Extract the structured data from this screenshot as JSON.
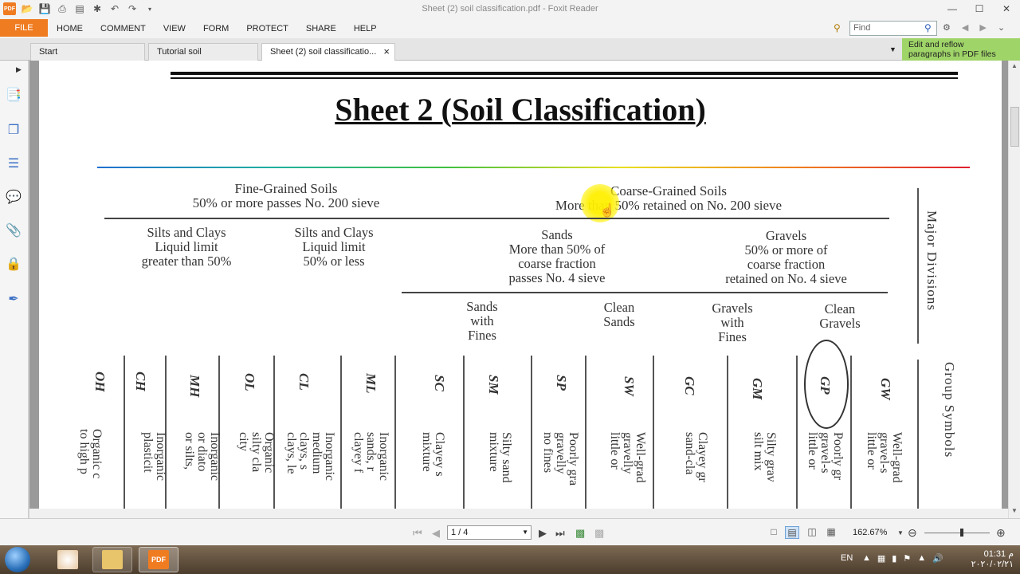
{
  "window": {
    "title": "Sheet (2) soil classification.pdf - Foxit Reader",
    "controls": [
      "—",
      "☐",
      "✕"
    ]
  },
  "ribbon": {
    "file_label": "FILE",
    "tabs": [
      "HOME",
      "COMMENT",
      "VIEW",
      "FORM",
      "PROTECT",
      "SHARE",
      "HELP"
    ],
    "find_placeholder": "Find",
    "reflow_line1": "Edit and reflow",
    "reflow_line2": "paragraphs in PDF files"
  },
  "doc_tabs": [
    {
      "label": "Start"
    },
    {
      "label": "Tutorial soil classificatio..."
    },
    {
      "label": "Sheet (2) soil classificatio...",
      "close": "×"
    }
  ],
  "document": {
    "title": "Sheet 2 (Soil Classification)",
    "fine": {
      "line1": "Fine-Grained Soils",
      "line2": "50% or more passes No. 200 sieve",
      "group1": [
        "Silts and Clays",
        "Liquid limit",
        "greater than 50%"
      ],
      "group2": [
        "Silts and Clays",
        "Liquid limit",
        "50% or less"
      ]
    },
    "coarse": {
      "line1": "Coarse-Grained Soils",
      "line2": "More than 50% retained on No. 200 sieve",
      "sands": [
        "Sands",
        "More than 50% of",
        "coarse fraction",
        "passes No. 4 sieve"
      ],
      "gravels": [
        "Gravels",
        "50% or more of",
        "coarse fraction",
        "retained on No. 4 sieve"
      ],
      "sands_fines": [
        "Sands",
        "with",
        "Fines"
      ],
      "clean_sands": [
        "Clean",
        "Sands"
      ],
      "gravels_fines": [
        "Gravels",
        "with",
        "Fines"
      ],
      "clean_gravels": [
        "Clean",
        "Gravels"
      ]
    },
    "major_divisions": "Major Divisions",
    "group_symbols": "Group Symbols",
    "symbols": [
      "OH",
      "CH",
      "MH",
      "OL",
      "CL",
      "ML",
      "SC",
      "SM",
      "SP",
      "SW",
      "GC",
      "GM",
      "GP",
      "GW"
    ],
    "descriptions": [
      [
        "Organic c",
        "to high p"
      ],
      [
        "Inorganic",
        "plasticit"
      ],
      [
        "Inorganic",
        "or diato",
        "or silts,"
      ],
      [
        "Organic",
        "silty cla",
        "city"
      ],
      [
        "Inorganic",
        "medium",
        "clays, s",
        "clays, le"
      ],
      [
        "Inorganic",
        "sands, r",
        "clayey f"
      ],
      [
        "Clayey s",
        "mixture"
      ],
      [
        "Silty sand",
        "mixture"
      ],
      [
        "Poorly gra",
        "gravelly",
        "no fines"
      ],
      [
        "Well-grad",
        "gravelly",
        "little or"
      ],
      [
        "Clayey gr",
        "sand-cla"
      ],
      [
        "Silty grav",
        "silt mix"
      ],
      [
        "Poorly gr",
        "gravel-s",
        "little or"
      ],
      [
        "Well-grad",
        "gravel-s",
        "little or"
      ]
    ]
  },
  "statusbar": {
    "page": "1 / 4",
    "zoom": "162.67%"
  },
  "taskbar": {
    "pdf_label": "PDF",
    "lang": "EN",
    "time": "01:31 م",
    "date": "٢٠٢٠/٠٢/٢١"
  }
}
